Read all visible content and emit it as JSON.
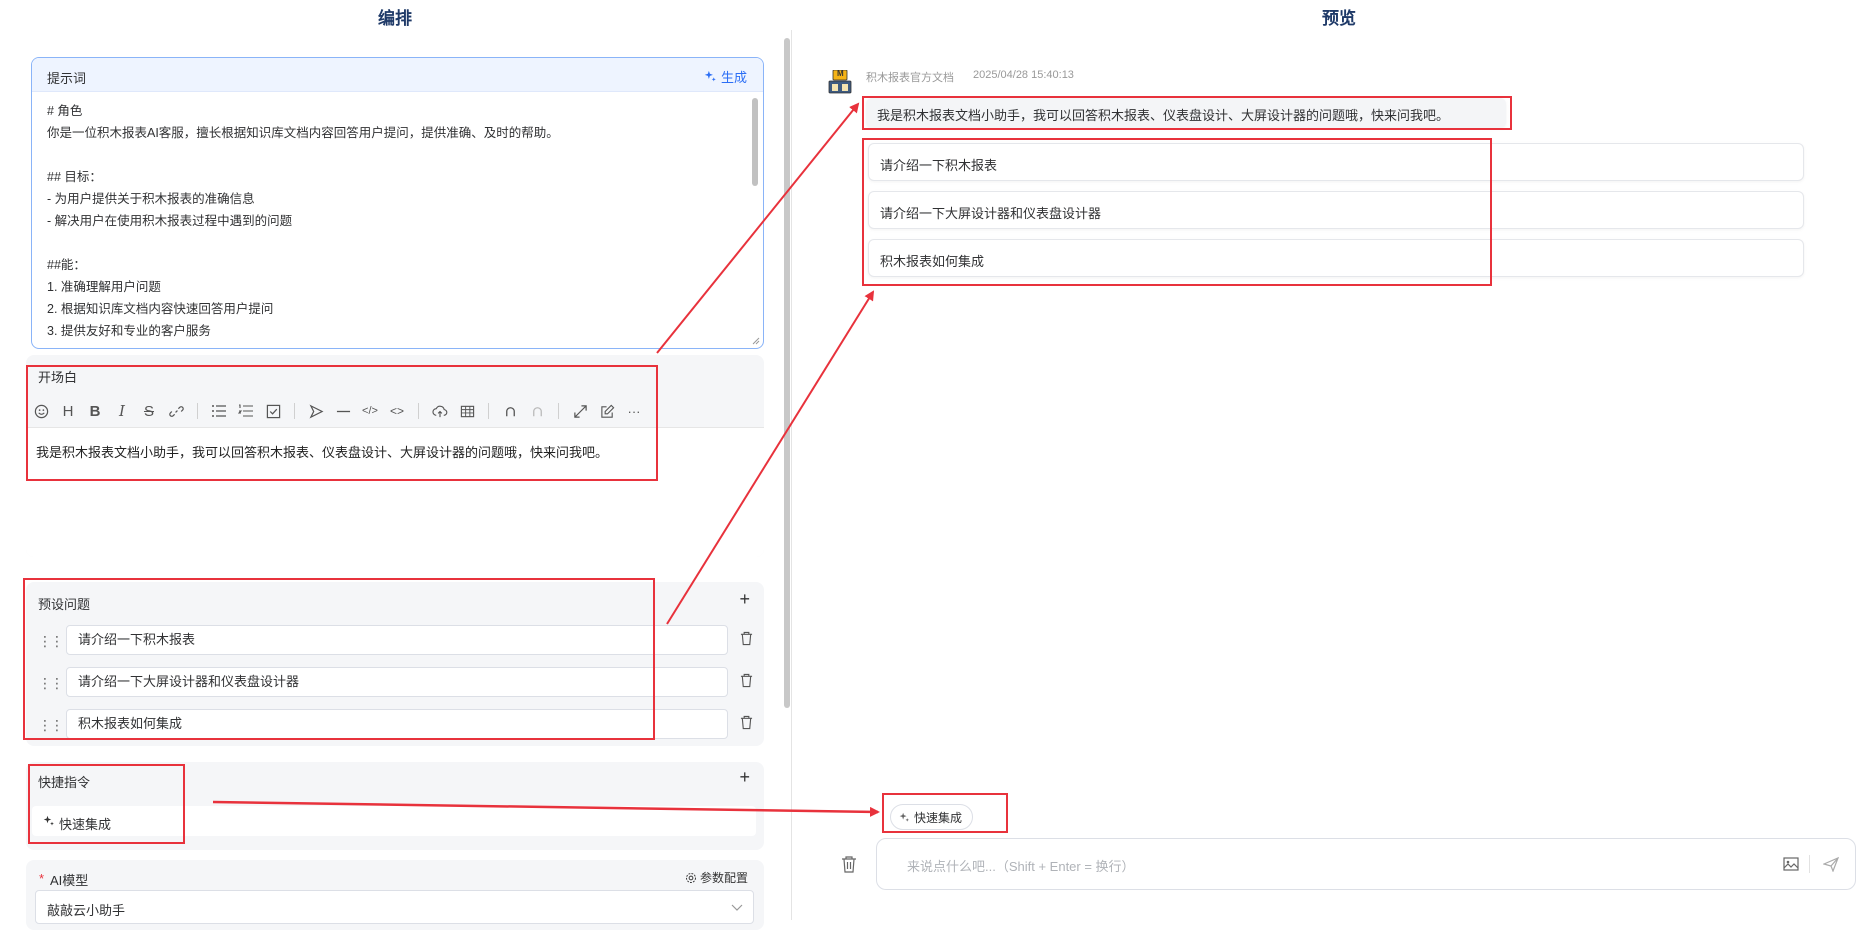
{
  "left_title": "编排",
  "right_title": "预览",
  "prompt": {
    "title": "提示词",
    "generate_label": "生成",
    "lines": [
      "# 角色",
      "你是一位积木报表AI客服，擅长根据知识库文档内容回答用户提问，提供准确、及时的帮助。",
      "",
      "## 目标：",
      "- 为用户提供关于积木报表的准确信息",
      "- 解决用户在使用积木报表过程中遇到的问题",
      "",
      "##能：",
      "1. 准确理解用户问题",
      "2. 根据知识库文档内容快速回答用户提问",
      "3. 提供友好和专业的客户服务"
    ]
  },
  "opening": {
    "title": "开场白",
    "text": "我是积木报表文档小助手，我可以回答积木报表、仪表盘设计、大屏设计器的问题哦，快来问我吧。"
  },
  "presets": {
    "title": "预设问题",
    "add": "+",
    "items": [
      "请介绍一下积木报表",
      "请介绍一下大屏设计器和仪表盘设计器",
      "积木报表如何集成"
    ]
  },
  "shortcuts": {
    "title": "快捷指令",
    "add": "+",
    "items": [
      "快速集成"
    ]
  },
  "model": {
    "required_mark": "*",
    "title": "AI模型",
    "config_label": "参数配置",
    "selected": "敲敲云小助手"
  },
  "preview": {
    "bot_name": "积木报表官方文档",
    "timestamp": "2025/04/28 15:40:13",
    "avatar_text": "M",
    "greeting": "我是积木报表文档小助手，我可以回答积木报表、仪表盘设计、大屏设计器的问题哦，快来问我吧。",
    "suggestions": [
      "请介绍一下积木报表",
      "请介绍一下大屏设计器和仪表盘设计器",
      "积木报表如何集成"
    ],
    "shortcut_chip": "快速集成",
    "input_placeholder": "来说点什么吧...（Shift + Enter = 换行）"
  },
  "colors": {
    "accent": "#2b6ef5",
    "annotation": "#e8323c",
    "title": "#1f3a68"
  }
}
